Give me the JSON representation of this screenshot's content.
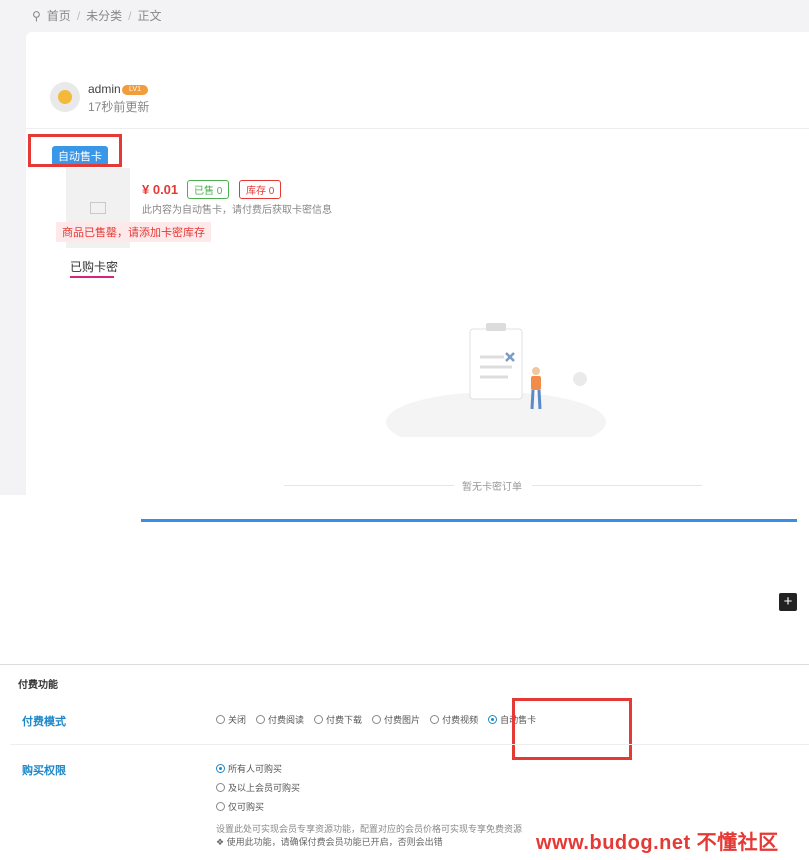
{
  "breadcrumb": {
    "items": [
      "首页",
      "未分类",
      "正文"
    ]
  },
  "author": {
    "name": "admin",
    "level": "LV1",
    "updated": "17秒前更新"
  },
  "product": {
    "tag": "自动售卡",
    "price": "¥ 0.01",
    "sold": "已售 0",
    "stock": "库存 0",
    "description": "此内容为自动售卡，请付费后获取卡密信息",
    "soldout_note": "商品已售罄，请添加卡密库存"
  },
  "tabs": {
    "bought": "已购卡密"
  },
  "empty": {
    "text": "暂无卡密订单"
  },
  "editor": {
    "add_symbol": "+"
  },
  "settings": {
    "section_title": "付费功能",
    "mode": {
      "label": "付费模式",
      "options": [
        "关闭",
        "付费阅读",
        "付费下载",
        "付费图片",
        "付费视频",
        "自动售卡"
      ],
      "selected": "自动售卡"
    },
    "permission": {
      "label": "购买权限",
      "options": [
        "所有人可购买",
        "及以上会员可购买",
        "仅可购买"
      ],
      "selected": "所有人可购买"
    },
    "help_text": "设置此处可实现会员专享资源功能，配置对应的会员价格可实现专享免费资源",
    "notice": "使用此功能，请确保付费会员功能已开启，否则会出错"
  },
  "watermark": "www.budog.net 不懂社区",
  "colors": {
    "accent": "#1e88c8",
    "highlight": "#e53935",
    "tab_underline": "#d6247a"
  }
}
